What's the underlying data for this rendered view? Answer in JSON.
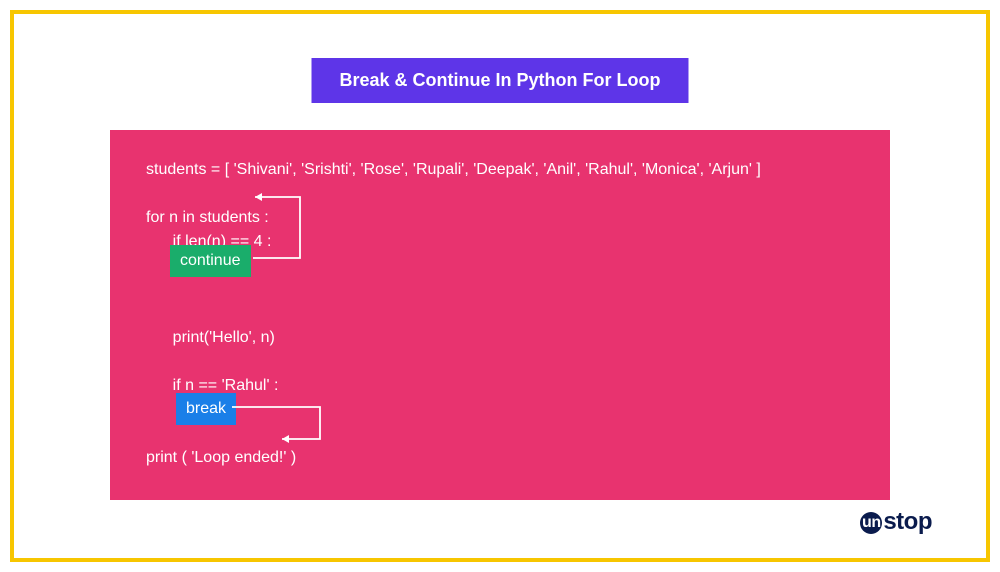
{
  "title": "Break & Continue In Python For Loop",
  "code": {
    "line1": "students = [ 'Shivani', 'Srishti', 'Rose', 'Rupali', 'Deepak', 'Anil', 'Rahul', 'Monica', 'Arjun' ]",
    "spacer1": "",
    "line2": "for n in students :",
    "line3": "      if len(n) == 4 :",
    "spacer2": "",
    "spacer3": "",
    "spacer4": "",
    "line4": "      print('Hello', n)",
    "spacer5": "",
    "line5": "      if n == 'Rahul' :",
    "spacer6": "",
    "spacer7": "",
    "line6": "print ( 'Loop ended!' )"
  },
  "tags": {
    "continue": "continue",
    "break": "break"
  },
  "logo": {
    "prefix": "un",
    "suffix": "stop"
  },
  "colors": {
    "frame": "#f7c600",
    "title_bg": "#5e35e8",
    "code_bg": "#e8336f",
    "continue_bg": "#1aad6b",
    "break_bg": "#1a7fe8",
    "logo": "#0a1b4d"
  }
}
